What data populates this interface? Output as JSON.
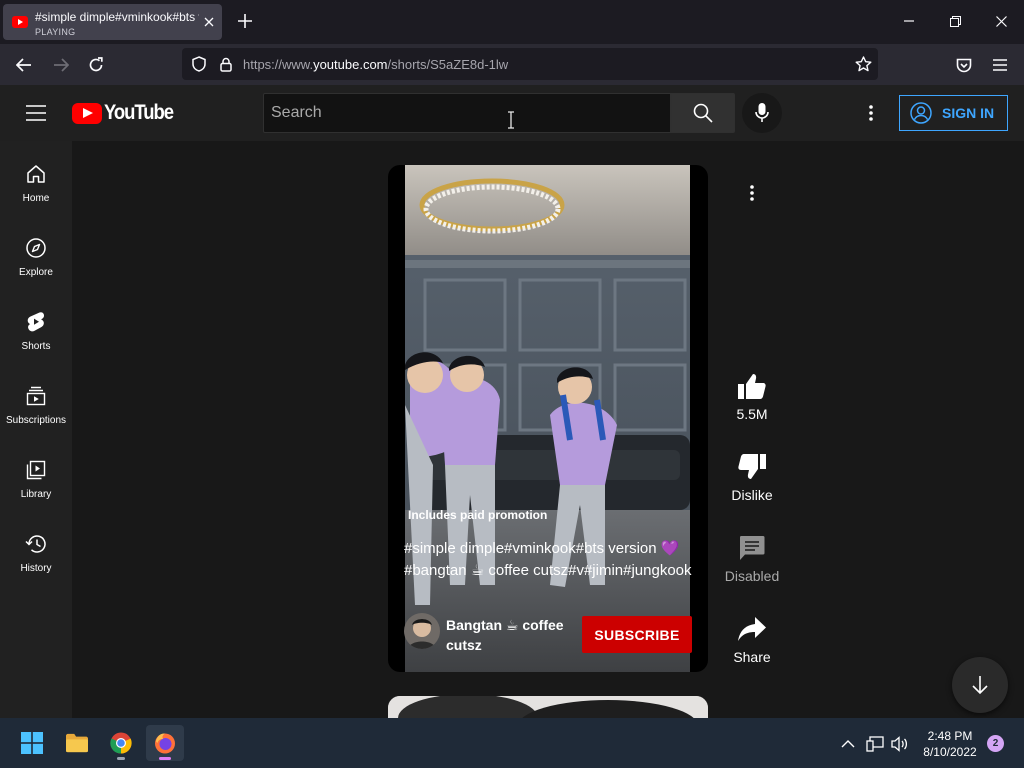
{
  "browser": {
    "tab": {
      "title": "#simple dimple#vminkook#bts version",
      "status": "PLAYING"
    },
    "url": {
      "prefix": "https://www.",
      "domain": "youtube.com",
      "path": "/shorts/S5aZE8d-1lw"
    }
  },
  "youtube": {
    "logo_text": "YouTube",
    "search": {
      "placeholder": "Search",
      "value": ""
    },
    "sign_in_label": "SIGN IN",
    "sidebar": [
      {
        "label": "Home",
        "icon": "home-icon"
      },
      {
        "label": "Explore",
        "icon": "compass-icon"
      },
      {
        "label": "Shorts",
        "icon": "shorts-icon"
      },
      {
        "label": "Subscriptions",
        "icon": "subscriptions-icon"
      },
      {
        "label": "Library",
        "icon": "library-icon"
      },
      {
        "label": "History",
        "icon": "history-icon"
      }
    ],
    "short": {
      "promo": "Includes paid promotion",
      "description": "#simple dimple#vminkook#bts version 💜 #bangtan ☕ coffee cutsz#v#jimin#jungkook",
      "channel": "Bangtan ☕ coffee cutsz",
      "subscribe_label": "SUBSCRIBE",
      "like_count": "5.5M",
      "dislike_label": "Dislike",
      "comments_label": "Disabled",
      "share_label": "Share"
    },
    "colors": {
      "brand_red": "#ff0000",
      "subscribe_red": "#cc0000",
      "link_blue": "#3ea6ff"
    }
  },
  "taskbar": {
    "time": "2:48 PM",
    "date": "8/10/2022",
    "notification_count": "2"
  }
}
